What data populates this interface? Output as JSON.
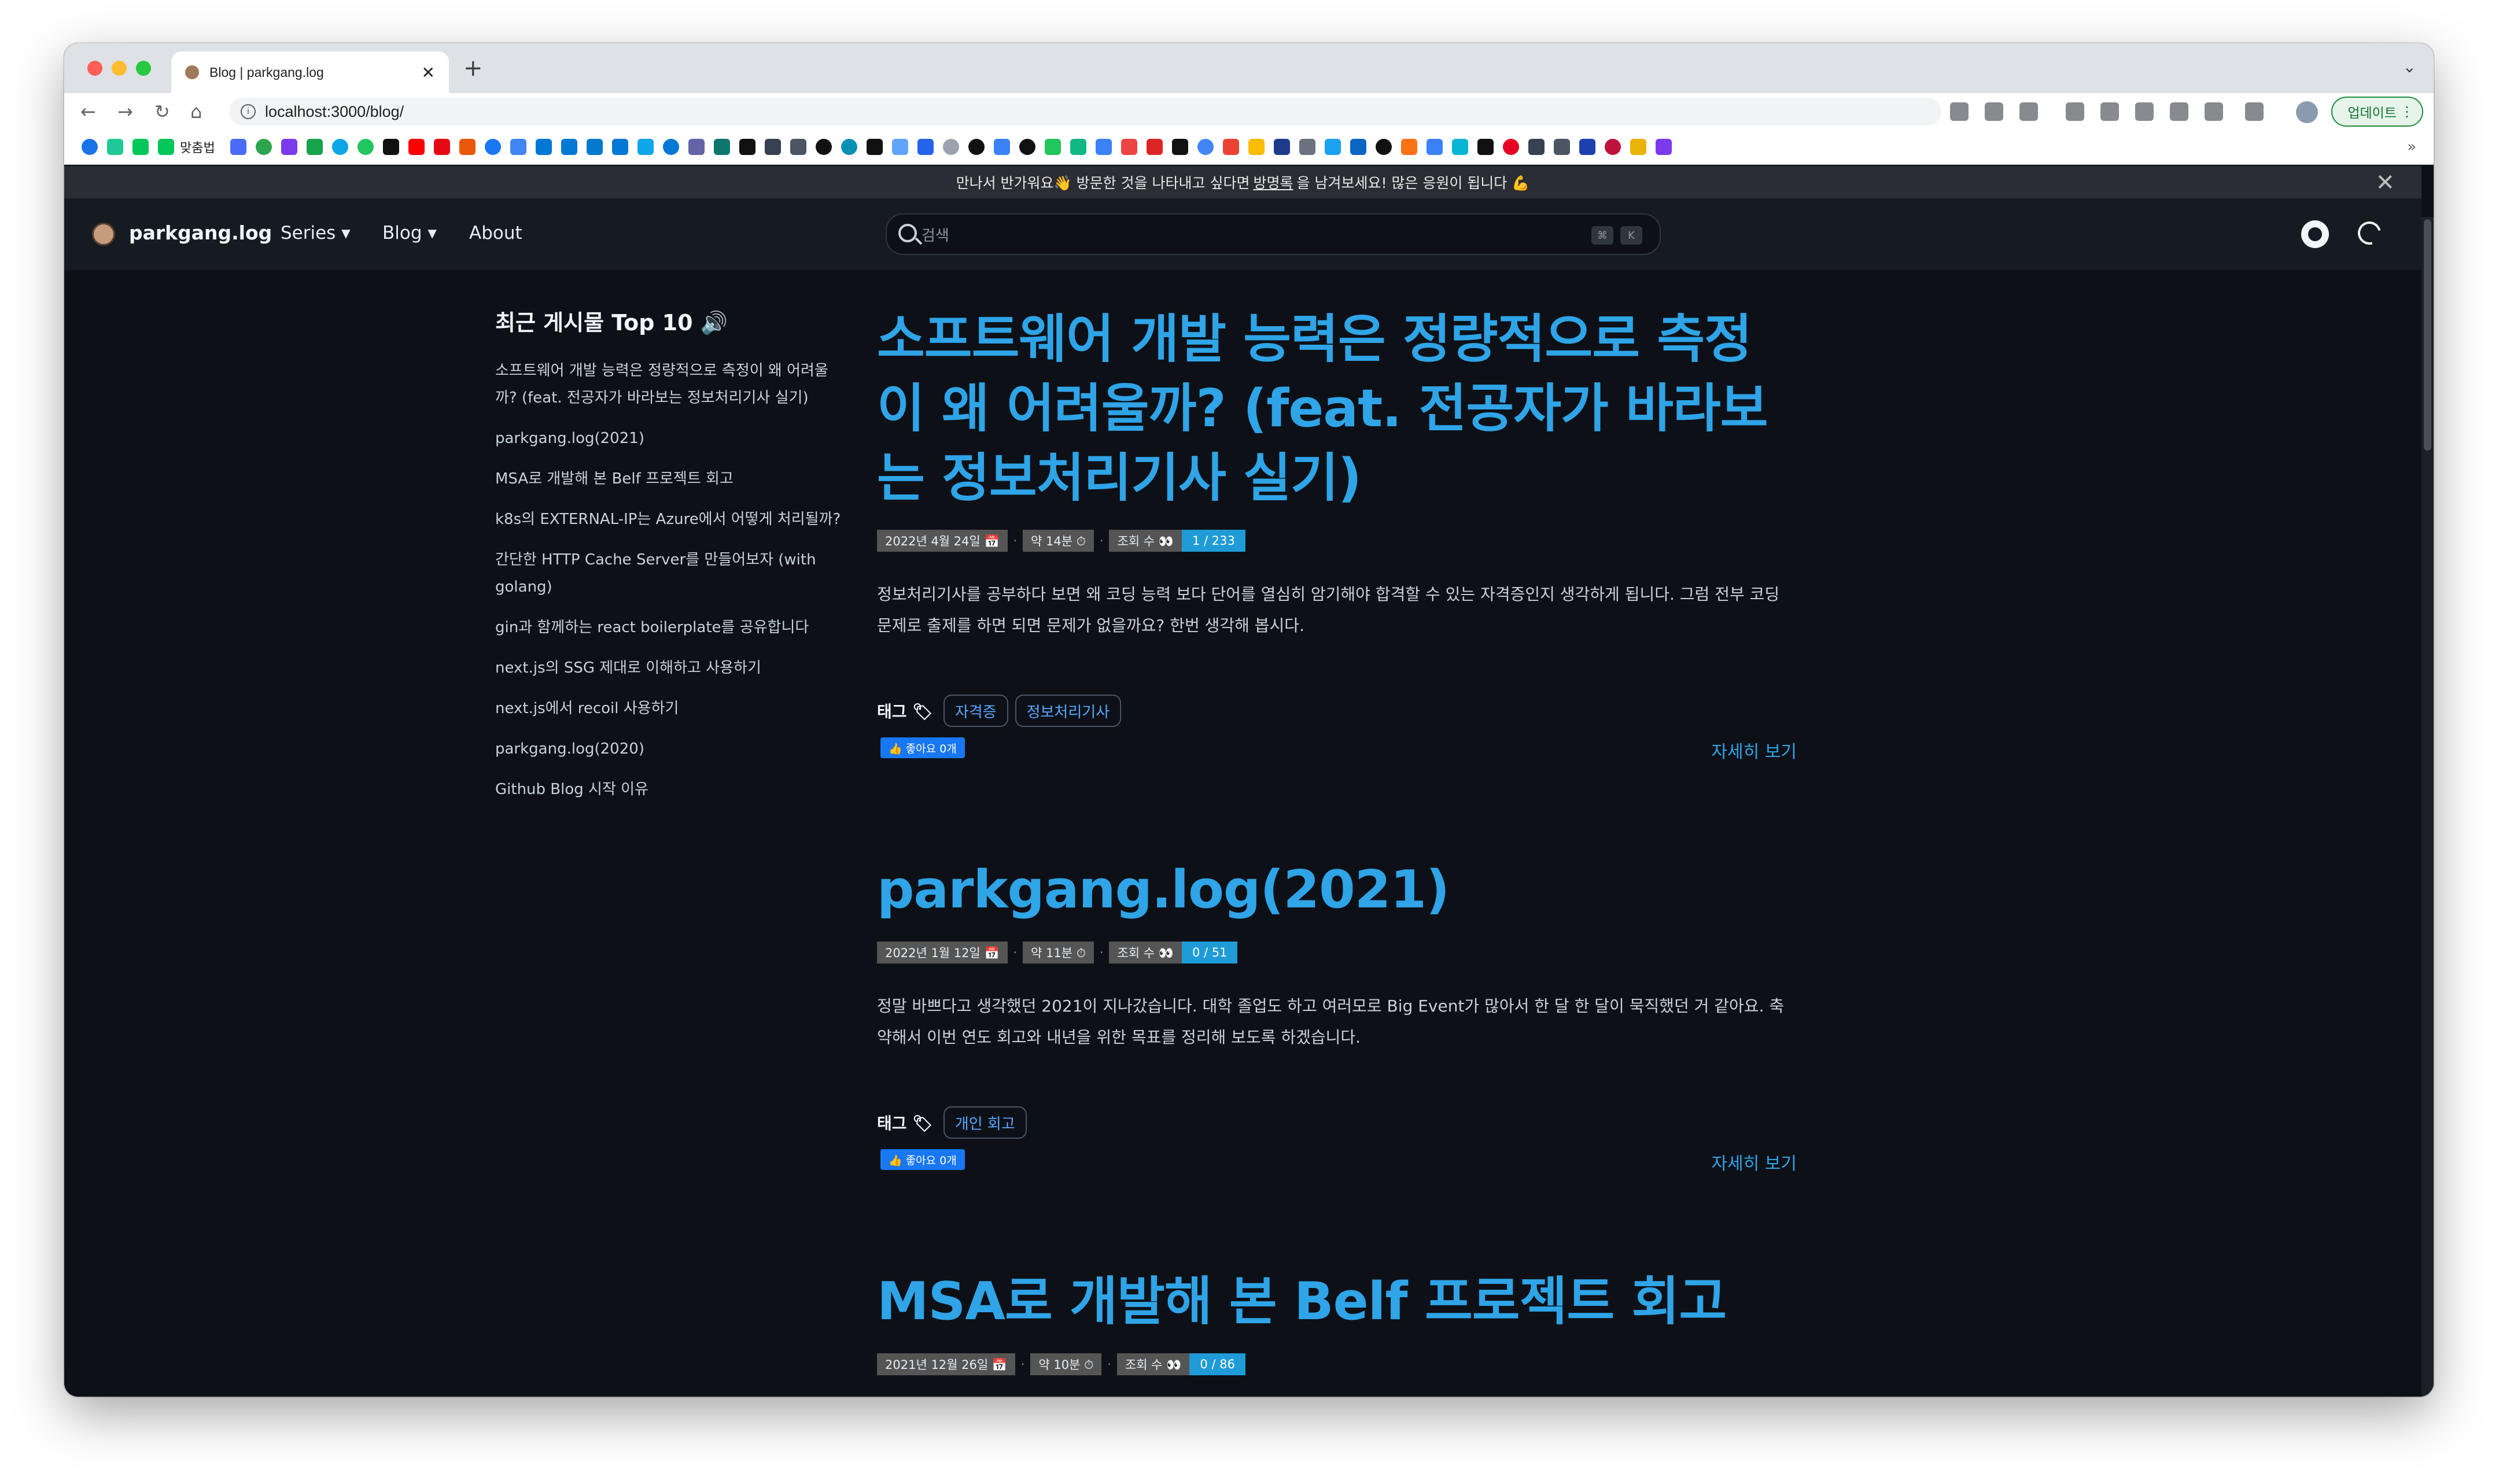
{
  "browser": {
    "tab_title": "Blog | parkgang.log",
    "new_tab": "+",
    "url": "localhost:3000/blog/",
    "update_label": "업데이트",
    "bookmark_label_1": "맞춤법"
  },
  "announcement": {
    "part1": "만나서 반가워요👋 방문한 것을 나타내고 싶다면",
    "link": "방명록",
    "part2": "을 남겨보세요! 많은 응원이 됩니다 💪",
    "close": "✕"
  },
  "header": {
    "logo": "parkgang.log",
    "nav": [
      {
        "label": "Series ▾"
      },
      {
        "label": "Blog ▾"
      },
      {
        "label": "About"
      }
    ],
    "search_placeholder": "검색",
    "search_kbd": [
      "⌘",
      "K"
    ]
  },
  "sidebar": {
    "title": "최근 게시물 Top 10 🔊",
    "items": [
      "소프트웨어 개발 능력은 정량적으로 측정이 왜 어려울까? (feat. 전공자가 바라보는 정보처리기사 실기)",
      "parkgang.log(2021)",
      "MSA로 개발해 본 Belf 프로젝트 회고",
      "k8s의 EXTERNAL-IP는 Azure에서 어떻게 처리될까?",
      "간단한 HTTP Cache Server를 만들어보자 (with golang)",
      "gin과 함께하는 react boilerplate를 공유합니다",
      "next.js의 SSG 제대로 이해하고 사용하기",
      "next.js에서 recoil 사용하기",
      "parkgang.log(2020)",
      "Github Blog 시작 이유"
    ]
  },
  "posts": [
    {
      "title": "소프트웨어 개발 능력은 정량적으로 측정이 왜 어려울까? (feat. 전공자가 바라보는 정보처리기사 실기)",
      "date": "2022년 4월 24일 📅",
      "read_time": "약 14분 ⏱",
      "views_label": "조회 수 👀",
      "views": "1 / 233",
      "excerpt": "정보처리기사를 공부하다 보면 왜 코딩 능력 보다 단어를 열심히 암기해야 합격할 수 있는 자격증인지 생각하게 됩니다. 그럼 전부 코딩 문제로 출제를 하면 되면 문제가 없을까요? 한번 생각해 봅시다.",
      "tags_label": "태그 🏷",
      "tags": [
        "자격증",
        "정보처리기사"
      ],
      "like": "👍 좋아요 0개",
      "more": "자세히 보기"
    },
    {
      "title": "parkgang.log(2021)",
      "date": "2022년 1월 12일 📅",
      "read_time": "약 11분 ⏱",
      "views_label": "조회 수 👀",
      "views": "0 / 51",
      "excerpt": "정말 바쁘다고 생각했던 2021이 지나갔습니다. 대학 졸업도 하고 여러모로 Big Event가 많아서 한 달 한 달이 묵직했던 거 같아요. 축약해서 이번 연도 회고와 내년을 위한 목표를 정리해 보도록 하겠습니다.",
      "tags_label": "태그 🏷",
      "tags": [
        "개인 회고"
      ],
      "like": "👍 좋아요 0개",
      "more": "자세히 보기"
    },
    {
      "title": "MSA로 개발해 본 Belf 프로젝트 회고",
      "date": "2021년 12월 26일 📅",
      "read_time": "약 10분 ⏱",
      "views_label": "조회 수 👀",
      "views": "0 / 86"
    }
  ],
  "colors": {
    "accent": "#2fa4e7",
    "page_bg": "#0d1117",
    "header_bg": "#161b22",
    "badge_accent": "#1f9bd7",
    "like_blue": "#1877f2"
  }
}
